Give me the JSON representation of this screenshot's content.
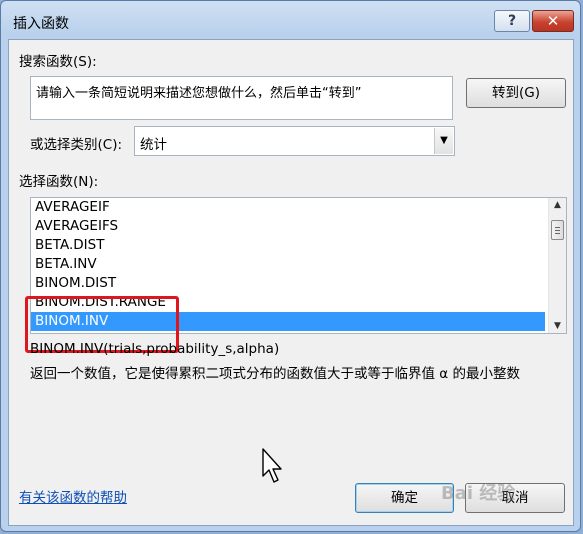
{
  "window": {
    "title": "插入函数",
    "help_label": "?",
    "close_label": "✕"
  },
  "search": {
    "label": "搜索函数(S):",
    "value": "请输入一条简短说明来描述您想做什么，然后单击“转到”",
    "goto_label": "转到(G)"
  },
  "category": {
    "label": "或选择类别(C):",
    "selected": "统计"
  },
  "functions": {
    "label": "选择函数(N):",
    "items": [
      "AVERAGEIF",
      "AVERAGEIFS",
      "BETA.DIST",
      "BETA.INV",
      "BINOM.DIST",
      "BINOM.DIST.RANGE",
      "BINOM.INV"
    ],
    "selected_index": 6,
    "signature": "BINOM.INV(trials,probability_s,alpha)",
    "description": "返回一个数值，它是使得累积二项式分布的函数值大于或等于临界值 α 的最小整数"
  },
  "footer": {
    "help_link": "有关该函数的帮助",
    "ok_label": "确定",
    "cancel_label": "取消"
  },
  "watermark": "Bai 经验",
  "colors": {
    "selection": "#3399ff",
    "highlight_box": "#e0161e",
    "link": "#0d4fb5"
  }
}
